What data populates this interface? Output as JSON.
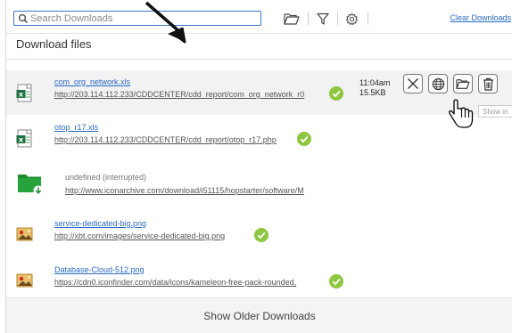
{
  "toolbar": {
    "search_placeholder": "Search Downloads",
    "clear_label": "Clear Downloads",
    "icons": [
      "search-icon",
      "folder-icon",
      "filter-icon",
      "gear-icon"
    ]
  },
  "header": {
    "title": "Download files"
  },
  "downloads": [
    {
      "name": "com_org_network.xls",
      "url": "http://203.114.112.233/CDDCENTER/cdd_report/com_org_network_r0",
      "time": "11:04am",
      "size": "15.5KB",
      "icon": "excel-file-icon"
    },
    {
      "name": "otop_r17.xls",
      "url": "http://203.114.112.233/CDDCENTER/cdd_report/otop_r17.php",
      "icon": "excel-file-icon"
    },
    {
      "name": "undefined (interrupted)",
      "url": "http://www.iconarchive.com/download/i51115/hopstarter/software/M",
      "icon": "green-folder-download-icon"
    },
    {
      "name": "service-dedicated-big.png",
      "url": "http://xbt.com/images/service-dedicated-big.png",
      "icon": "image-file-icon"
    },
    {
      "name": "Database-Cloud-512.png",
      "url": "https://cdn0.iconfinder.com/data/icons/kameleon-free-pack-rounded,",
      "icon": "image-file-icon"
    }
  ],
  "row_actions": [
    "close-icon",
    "globe-icon",
    "folder-icon",
    "trash-icon"
  ],
  "tooltip": "Show in",
  "footer": {
    "label": "Show Older Downloads"
  },
  "colors": {
    "accent": "#2a6bc4",
    "check": "#8dc63f",
    "search_border": "#3c78c8"
  }
}
